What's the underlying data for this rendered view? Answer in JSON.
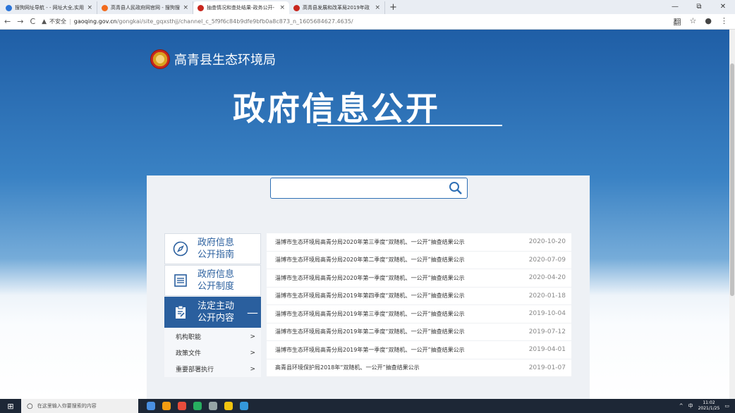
{
  "browser": {
    "tabs": [
      {
        "label": "搜狗网址导航 - - 网址大全,实用",
        "color": "#2a74d8"
      },
      {
        "label": "高青县人民政府网官网 - 搜狗搜",
        "color": "#f26b1d"
      },
      {
        "label": "抽查情况和查处结果-政务公开-",
        "color": "#c8261d"
      },
      {
        "label": "高青县发展和改革局2019年政",
        "color": "#c8261d"
      }
    ],
    "active_tab": 2,
    "new_tab": "+",
    "win_minimize": "—",
    "win_restore": "⧉",
    "win_close": "✕",
    "back": "←",
    "forward": "→",
    "reload": "C",
    "security_icon": "▲",
    "security_text": "不安全",
    "url_host": "gaoqing.gov.cn",
    "url_path": "/gongkai/site_gqxsthjj/channel_c_5f9f6c84b9dfe9bfb0a8c873_n_1605684627.4635/",
    "tool_translate": "翻",
    "tool_star": "☆",
    "tool_profile": "●",
    "tool_menu": "⋮"
  },
  "header": {
    "dept": "高青县生态环境局",
    "hero": "政府信息公开"
  },
  "sidebar": {
    "items": [
      {
        "label": "政府信息公开指南",
        "icon": "compass-icon"
      },
      {
        "label": "政府信息公开制度",
        "icon": "list-doc-icon"
      },
      {
        "label": "法定主动公开内容",
        "icon": "clipboard-edit-icon",
        "active": true,
        "toggle": "—"
      }
    ],
    "subitems": [
      {
        "label": "机构职能",
        "arrow": ">"
      },
      {
        "label": "政策文件",
        "arrow": ">"
      },
      {
        "label": "重要部署执行",
        "arrow": ">"
      }
    ]
  },
  "list": {
    "rows": [
      {
        "title": "淄博市生态环境局高青分局2020年第三季度“双随机、一公开”抽查结果公示",
        "date": "2020-10-20"
      },
      {
        "title": "淄博市生态环境局高青分局2020年第二季度“双随机、一公开”抽查结果公示",
        "date": "2020-07-09"
      },
      {
        "title": "淄博市生态环境局高青分局2020年第一季度“双随机、一公开”抽查结果公示",
        "date": "2020-04-20"
      },
      {
        "title": "淄博市生态环境局高青分局2019年第四季度“双随机、一公开”抽查结果公示",
        "date": "2020-01-18"
      },
      {
        "title": "淄博市生态环境局高青分局2019年第三季度“双随机、一公开”抽查结果公示",
        "date": "2019-10-04"
      },
      {
        "title": "淄博市生态环境局高青分局2019年第二季度“双随机、一公开”抽查结果公示",
        "date": "2019-07-12"
      },
      {
        "title": "淄博市生态环境局高青分局2019年第一季度“双随机、一公开”抽查结果公示",
        "date": "2019-04-01"
      },
      {
        "title": "高青县环境保护局2018年“双随机、一公开”抽查结果公示",
        "date": "2019-01-07"
      }
    ]
  },
  "taskbar": {
    "search_placeholder": "在这里输入你要搜索的内容",
    "tray_ime": "中",
    "time": "11:02",
    "date": "2021/1/25",
    "app_colors": [
      "#4a90e2",
      "#f39c12",
      "#e74c3c",
      "#27ae60",
      "#95a5a6",
      "#f1c40f",
      "#3498db"
    ]
  }
}
